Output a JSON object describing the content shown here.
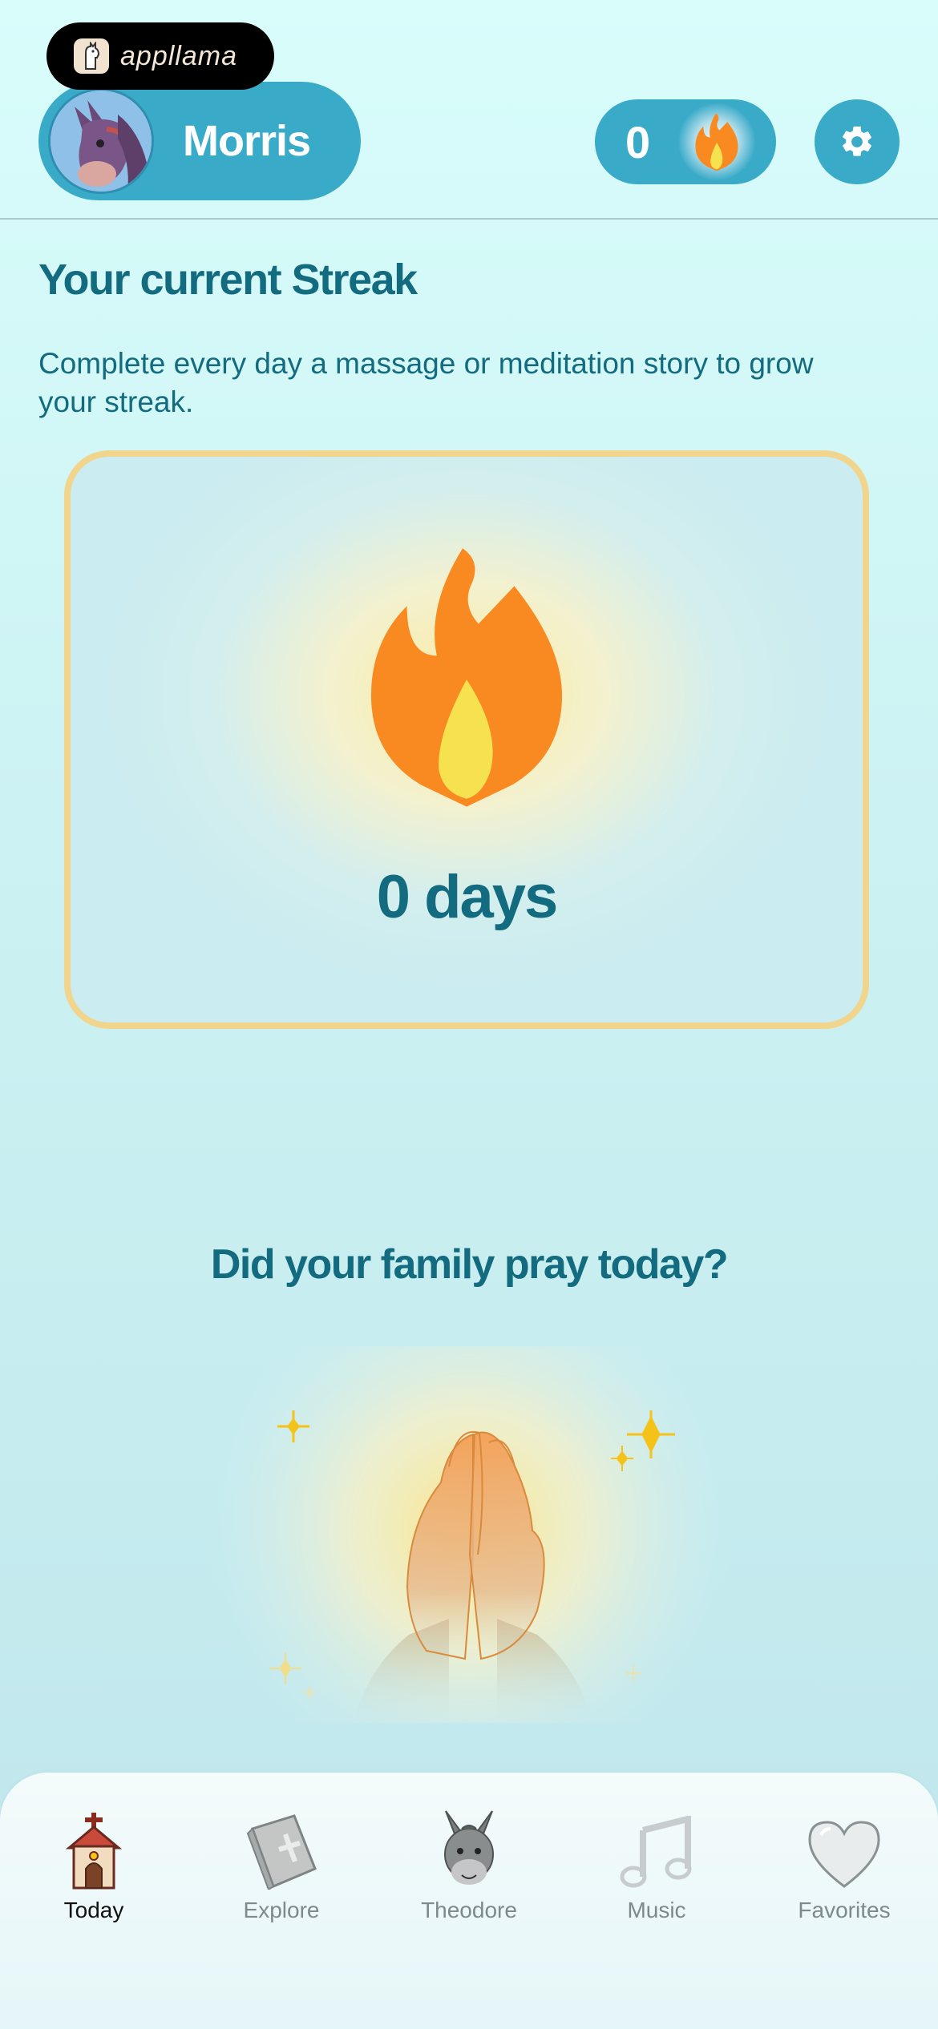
{
  "brand": {
    "name": "appllama"
  },
  "user": {
    "name": "Morris"
  },
  "header": {
    "streak_count": "0"
  },
  "streak_section": {
    "title": "Your current Streak",
    "description": "Complete every day a massage or meditation story to grow your streak.",
    "days_label": "0 days"
  },
  "prayer_section": {
    "title": "Did your family pray today?"
  },
  "nav": {
    "items": [
      {
        "label": "Today",
        "icon": "church-icon",
        "active": true
      },
      {
        "label": "Explore",
        "icon": "bible-icon",
        "active": false
      },
      {
        "label": "Theodore",
        "icon": "donkey-icon",
        "active": false
      },
      {
        "label": "Music",
        "icon": "music-note-icon",
        "active": false
      },
      {
        "label": "Favorites",
        "icon": "heart-icon",
        "active": false
      }
    ]
  },
  "colors": {
    "primary": "#3aaac9",
    "heading": "#136b80",
    "flame_orange": "#f98a22",
    "flame_yellow": "#f6e24f",
    "card_border": "#f1d58c"
  }
}
